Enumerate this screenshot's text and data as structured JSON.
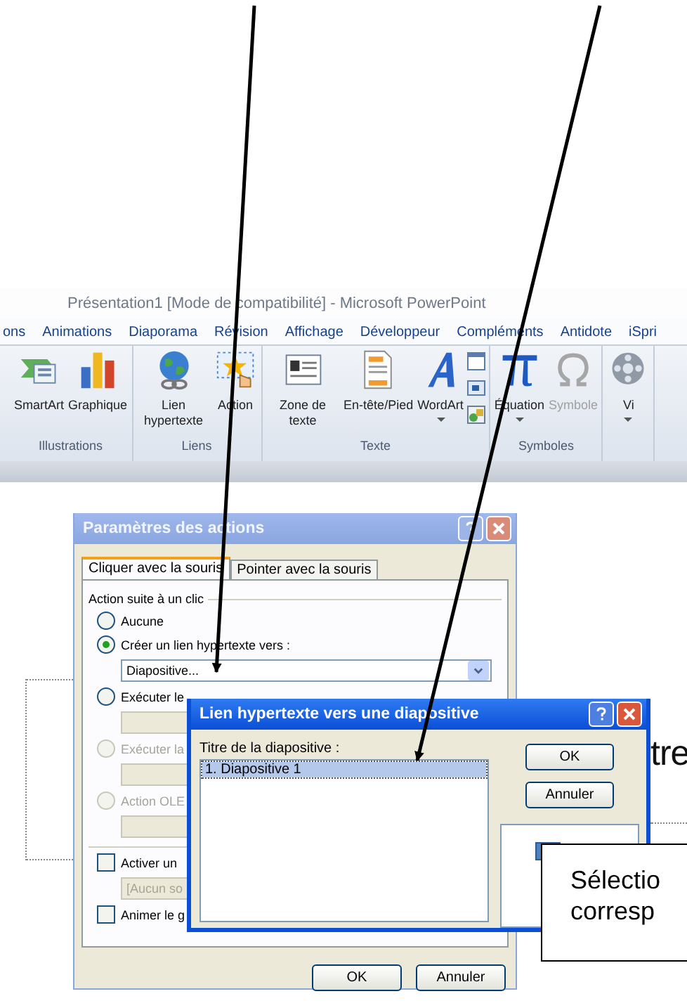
{
  "ribbon": {
    "title": "Présentation1 [Mode de compatibilité] - Microsoft PowerPoint",
    "tabs": [
      {
        "label": "ons"
      },
      {
        "label": "Animations"
      },
      {
        "label": "Diaporama"
      },
      {
        "label": "Révision"
      },
      {
        "label": "Affichage"
      },
      {
        "label": "Développeur"
      },
      {
        "label": "Compléments"
      },
      {
        "label": "Antidote"
      },
      {
        "label": "iSpri"
      }
    ],
    "groups": [
      {
        "label": "Illustrations",
        "buttons": [
          {
            "kind": "smartart",
            "label": "SmartArt",
            "disabled": false
          },
          {
            "kind": "chart",
            "label": "Graphique",
            "disabled": false
          }
        ]
      },
      {
        "label": "Liens",
        "buttons": [
          {
            "kind": "globe",
            "label": "Lien hypertexte",
            "disabled": false
          },
          {
            "kind": "action",
            "label": "Action",
            "disabled": false
          }
        ]
      },
      {
        "label": "Texte",
        "buttons": [
          {
            "kind": "textbox",
            "label": "Zone de texte",
            "disabled": false
          },
          {
            "kind": "header",
            "label": "En-tête/Pied",
            "disabled": false
          },
          {
            "kind": "wordart",
            "label": "WordArt",
            "dropdown": true,
            "disabled": false
          },
          {
            "kind": "smallicons"
          }
        ]
      },
      {
        "label": "Symboles",
        "buttons": [
          {
            "kind": "pi",
            "label": "Équation",
            "dropdown": true,
            "disabled": false
          },
          {
            "kind": "omega",
            "label": "Symbole",
            "disabled": true
          }
        ]
      },
      {
        "buttons": [
          {
            "kind": "video",
            "label": "Vi",
            "dropdown": true,
            "disabled": false
          }
        ]
      }
    ]
  },
  "slide": {
    "title_fragment": "tre"
  },
  "action_dialog": {
    "title": "Paramètres des actions",
    "tabs": [
      {
        "label": "Cliquer avec la souris",
        "selected": true
      },
      {
        "label": "Pointer avec la souris",
        "selected": false
      }
    ],
    "group_label": "Action suite à un clic",
    "options": [
      {
        "label": "Aucune",
        "selected": false,
        "disabled": false
      },
      {
        "label": "Créer un lien hypertexte vers :",
        "selected": true,
        "disabled": false,
        "field": {
          "kind": "dropdown",
          "value": "Diapositive...",
          "disabled": false
        }
      },
      {
        "label": "Exécuter le",
        "selected": false,
        "disabled": false,
        "field": {
          "kind": "blank",
          "disabled": true
        }
      },
      {
        "label": "Exécuter la",
        "selected": false,
        "disabled": true,
        "field": {
          "kind": "blank",
          "disabled": true
        }
      },
      {
        "label": "Action OLE",
        "selected": false,
        "disabled": true,
        "field": {
          "kind": "blank",
          "disabled": true
        }
      }
    ],
    "checkboxes": [
      {
        "label": "Activer un",
        "checked": false,
        "field": {
          "value": "[Aucun so",
          "disabled": true
        }
      },
      {
        "label": "Animer le g",
        "checked": false
      }
    ],
    "buttons": [
      "OK",
      "Annuler"
    ]
  },
  "slide_dialog": {
    "title": "Lien hypertexte vers une diapositive",
    "list_label": "Titre de la diapositive :",
    "slides": [
      {
        "label": "1. Diapositive 1",
        "selected": true
      }
    ],
    "buttons": [
      "OK",
      "Annuler"
    ]
  },
  "callout": {
    "lines": [
      "Sélectio",
      "corresp"
    ]
  }
}
